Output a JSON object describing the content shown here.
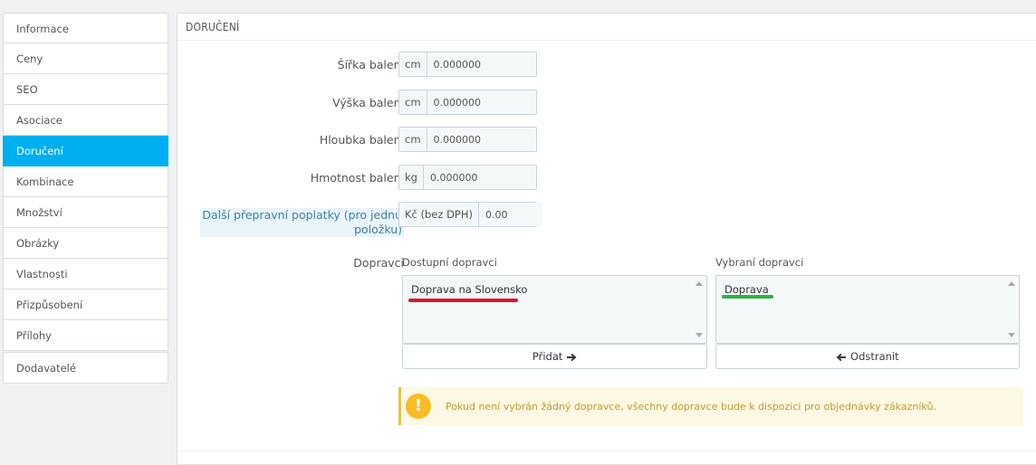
{
  "sidebar": {
    "items": [
      {
        "label": "Informace"
      },
      {
        "label": "Ceny"
      },
      {
        "label": "SEO"
      },
      {
        "label": "Asociace"
      },
      {
        "label": "Doručení"
      },
      {
        "label": "Kombinace"
      },
      {
        "label": "Množství"
      },
      {
        "label": "Obrázky"
      },
      {
        "label": "Vlastnosti"
      },
      {
        "label": "Přizpůsobení"
      },
      {
        "label": "Přílohy"
      },
      {
        "label": "Dodavatelé"
      }
    ],
    "active": "Doručení"
  },
  "panel": {
    "title": "DORUČENÍ",
    "fields": {
      "width": {
        "label": "Šířka balení",
        "unit": "cm",
        "value": "0.000000"
      },
      "height": {
        "label": "Výška balení",
        "unit": "cm",
        "value": "0.000000"
      },
      "depth": {
        "label": "Hloubka balení",
        "unit": "cm",
        "value": "0.000000"
      },
      "weight": {
        "label": "Hmotnost balení",
        "unit": "kg",
        "value": "0.000000"
      },
      "fee": {
        "label_line1": "Další přepravní poplatky (pro jednu",
        "label_line2": "položku)",
        "unit": "Kč (bez DPH)",
        "value": "0.00"
      }
    },
    "carriers": {
      "label": "Dopravci",
      "available_title": "Dostupní dopravci",
      "available_items": [
        "Doprava na Slovensko"
      ],
      "selected_title": "Vybraní dopravci",
      "selected_items": [
        "Doprava"
      ],
      "add_label": "Přidat",
      "remove_label": "Odstranit"
    },
    "alert": {
      "icon": "!",
      "text": "Pokud není vybrán žádný dopravce, všechny dopravce bude k dispozici pro objednávky zákazníků."
    }
  },
  "colors": {
    "accent": "#00aff0",
    "underline_red": "#e0162b",
    "underline_green": "#2fb344",
    "alert_bg": "#fcf8e3",
    "alert_icon": "#fbbb22"
  }
}
